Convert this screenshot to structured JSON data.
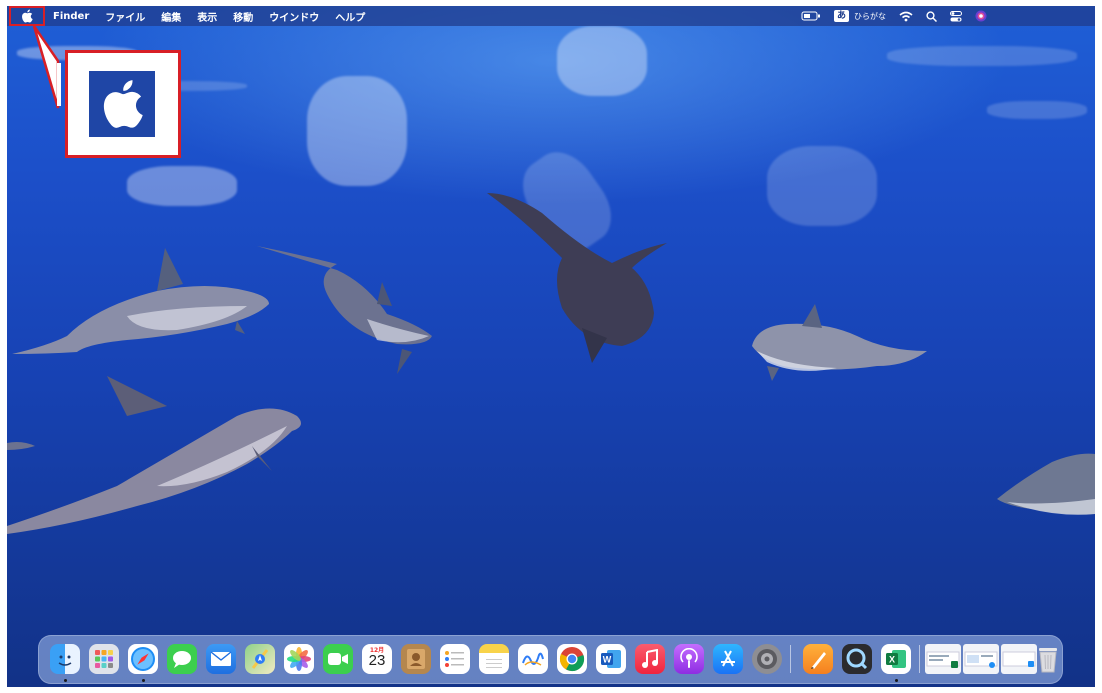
{
  "menubar": {
    "apple_menu": "apple-logo-icon",
    "items": [
      {
        "label": "Finder"
      },
      {
        "label": "ファイル"
      },
      {
        "label": "編集"
      },
      {
        "label": "表示"
      },
      {
        "label": "移動"
      },
      {
        "label": "ウインドウ"
      },
      {
        "label": "ヘルプ"
      }
    ],
    "status": {
      "input_method_badge": "あ",
      "input_method_label": "ひらがな"
    }
  },
  "callout": {
    "icon": "apple-logo-icon",
    "border_color": "#d81f26"
  },
  "dock": {
    "calendar": {
      "month": "12月",
      "day": "23"
    },
    "apps": [
      {
        "name": "Finder",
        "icon": "finder-icon",
        "running": true
      },
      {
        "name": "Launchpad",
        "icon": "launchpad-icon",
        "running": false
      },
      {
        "name": "Safari",
        "icon": "safari-icon",
        "running": true
      },
      {
        "name": "Messages",
        "icon": "messages-icon",
        "running": false
      },
      {
        "name": "Mail",
        "icon": "mail-icon",
        "running": false
      },
      {
        "name": "Maps",
        "icon": "maps-icon",
        "running": false
      },
      {
        "name": "Photos",
        "icon": "photos-icon",
        "running": false
      },
      {
        "name": "FaceTime",
        "icon": "facetime-icon",
        "running": false
      },
      {
        "name": "Calendar",
        "icon": "calendar-icon",
        "running": false
      },
      {
        "name": "Contacts",
        "icon": "contacts-icon",
        "running": false
      },
      {
        "name": "Reminders",
        "icon": "reminders-icon",
        "running": false
      },
      {
        "name": "Notes",
        "icon": "notes-icon",
        "running": false
      },
      {
        "name": "Freeform",
        "icon": "freeform-icon",
        "running": false
      },
      {
        "name": "Chrome",
        "icon": "chrome-icon",
        "running": false
      },
      {
        "name": "Word",
        "icon": "word-icon",
        "running": false
      },
      {
        "name": "Music",
        "icon": "music-icon",
        "running": false
      },
      {
        "name": "Podcasts",
        "icon": "podcasts-icon",
        "running": false
      },
      {
        "name": "App Store",
        "icon": "app-store-icon",
        "running": false
      },
      {
        "name": "System Settings",
        "icon": "system-settings-icon",
        "running": false
      },
      {
        "name": "Pages",
        "icon": "pages-icon",
        "running": false
      },
      {
        "name": "QuickTime",
        "icon": "quicktime-icon",
        "running": false
      },
      {
        "name": "Excel",
        "icon": "excel-icon",
        "running": true
      }
    ],
    "recent": [
      "window-thumbnail-icon",
      "window-thumbnail-icon",
      "window-thumbnail-icon"
    ],
    "trash": "trash-icon"
  }
}
